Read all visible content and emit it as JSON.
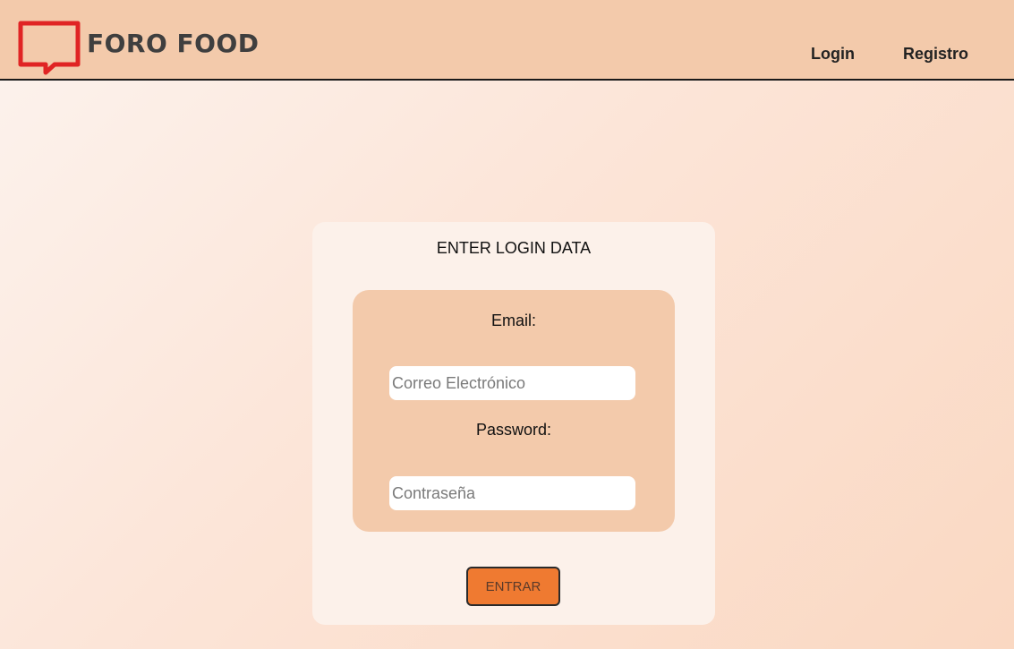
{
  "header": {
    "brand": "FORO FOOD",
    "logo_icon": "speech-bubble-icon",
    "nav": {
      "login": "Login",
      "registro": "Registro"
    }
  },
  "login_card": {
    "title": "ENTER LOGIN DATA",
    "email_label": "Email:",
    "email_placeholder": "Correo Electrónico",
    "email_value": "",
    "password_label": "Password:",
    "password_placeholder": "Contraseña",
    "password_value": "",
    "submit_label": "ENTRAR"
  },
  "colors": {
    "header_bg": "#f3caab",
    "logo_red": "#e02424",
    "card_bg": "#fcf1ea",
    "inner_bg": "#f3caab",
    "button_bg": "#ef7a31"
  }
}
